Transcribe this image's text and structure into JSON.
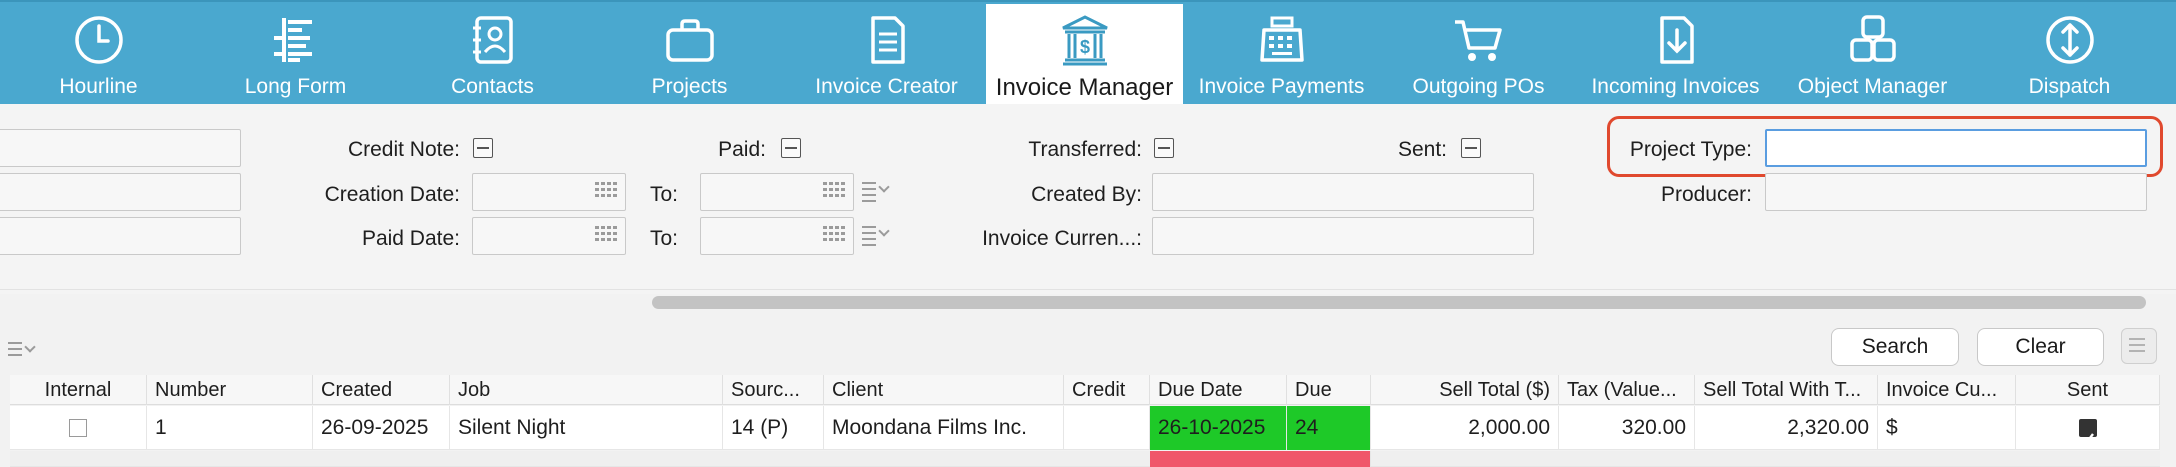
{
  "toolbar": {
    "tabs": [
      {
        "label": "Hourline",
        "icon": "clock-icon"
      },
      {
        "label": "Long Form",
        "icon": "long-form-icon"
      },
      {
        "label": "Contacts",
        "icon": "contacts-book-icon"
      },
      {
        "label": "Projects",
        "icon": "briefcase-icon"
      },
      {
        "label": "Invoice Creator",
        "icon": "document-icon"
      },
      {
        "label": "Invoice Manager",
        "icon": "bank-dollar-icon",
        "active": true
      },
      {
        "label": "Invoice Payments",
        "icon": "cash-register-icon"
      },
      {
        "label": "Outgoing POs",
        "icon": "shopping-cart-icon"
      },
      {
        "label": "Incoming Invoices",
        "icon": "file-download-icon"
      },
      {
        "label": "Object Manager",
        "icon": "objects-icon"
      },
      {
        "label": "Dispatch",
        "icon": "updown-arrows-icon"
      }
    ]
  },
  "filters": {
    "credit_note": "Credit Note:",
    "paid": "Paid:",
    "transferred": "Transferred:",
    "sent": "Sent:",
    "project_type": "Project Type:",
    "creation_date": "Creation Date:",
    "to1": "To:",
    "created_by": "Created By:",
    "producer": "Producer:",
    "paid_date": "Paid Date:",
    "to2": "To:",
    "invoice_currency": "Invoice Curren...:"
  },
  "buttons": {
    "search": "Search",
    "clear": "Clear"
  },
  "table": {
    "columns": [
      "Internal",
      "Number",
      "Created",
      "Job",
      "Sourc...",
      "Client",
      "Credit",
      "Due Date",
      "Due",
      "Sell Total ($)",
      "Tax (Value...",
      "Sell Total With T...",
      "Invoice Cu...",
      "Sent"
    ],
    "rows": [
      {
        "number": "1",
        "created": "26-09-2025",
        "job": "Silent Night",
        "source": "14 (P)",
        "client": "Moondana Films Inc.",
        "credit": "",
        "due_date": "26-10-2025",
        "due": "24",
        "sell_total": "2,000.00",
        "tax": "320.00",
        "sell_total_with_tax": "2,320.00",
        "currency": "$",
        "sent": true
      }
    ]
  },
  "colors": {
    "toolbar": "#4aa8cf",
    "due_green": "#1ec928",
    "due_red": "#f0566a",
    "highlight": "#e0492e"
  }
}
